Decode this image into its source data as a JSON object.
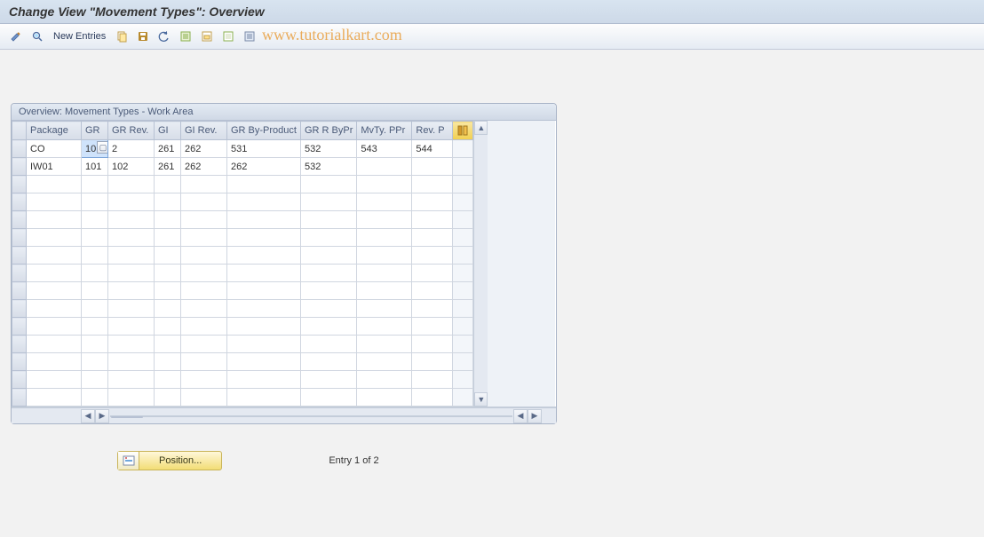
{
  "title": "Change View \"Movement Types\": Overview",
  "toolbar": {
    "new_entries_label": "New Entries"
  },
  "watermark": "www.tutorialkart.com",
  "panel": {
    "title": "Overview: Movement Types - Work Area"
  },
  "columns": {
    "package": "Package",
    "gr": "GR",
    "gr_rev": "GR Rev.",
    "gi": "GI",
    "gi_rev": "GI Rev.",
    "gr_byp": "GR By-Product",
    "gr_r_byp": "GR R ByPr",
    "mvty_ppr": "MvTy. PPr",
    "rev_p": "Rev. P"
  },
  "rows": [
    {
      "package": "CO",
      "gr": "101",
      "gr_rev": "2",
      "gi": "261",
      "gi_rev": "262",
      "gr_byp": "531",
      "gr_r_byp": "532",
      "mvty_ppr": "543",
      "rev_p": "544"
    },
    {
      "package": "IW01",
      "gr": "101",
      "gr_rev": "102",
      "gi": "261",
      "gi_rev": "262",
      "gr_byp": "262",
      "gr_r_byp": "532",
      "mvty_ppr": "",
      "rev_p": ""
    }
  ],
  "footer": {
    "position_label": "Position...",
    "entry_text": "Entry 1 of 2"
  }
}
